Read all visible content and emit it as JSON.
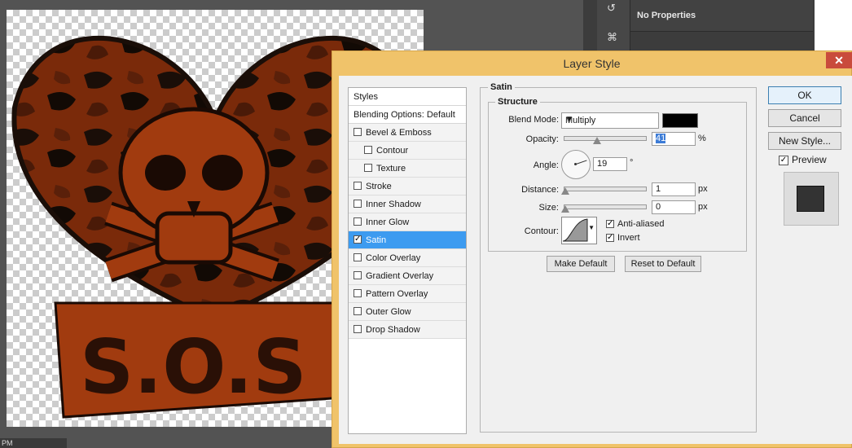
{
  "status_text": "PM",
  "right_panel": {
    "no_properties": "No Properties"
  },
  "dialog": {
    "title": "Layer Style",
    "styles_header": "Styles",
    "blending_options": "Blending Options: Default",
    "effects": [
      {
        "label": "Bevel & Emboss",
        "checked": false,
        "indent": false
      },
      {
        "label": "Contour",
        "checked": false,
        "indent": true
      },
      {
        "label": "Texture",
        "checked": false,
        "indent": true
      },
      {
        "label": "Stroke",
        "checked": false,
        "indent": false
      },
      {
        "label": "Inner Shadow",
        "checked": false,
        "indent": false
      },
      {
        "label": "Inner Glow",
        "checked": false,
        "indent": false
      },
      {
        "label": "Satin",
        "checked": true,
        "indent": false,
        "selected": true
      },
      {
        "label": "Color Overlay",
        "checked": false,
        "indent": false
      },
      {
        "label": "Gradient Overlay",
        "checked": false,
        "indent": false
      },
      {
        "label": "Pattern Overlay",
        "checked": false,
        "indent": false
      },
      {
        "label": "Outer Glow",
        "checked": false,
        "indent": false
      },
      {
        "label": "Drop Shadow",
        "checked": false,
        "indent": false
      }
    ],
    "satin": {
      "group_title": "Satin",
      "structure_title": "Structure",
      "blend_mode_label": "Blend Mode:",
      "blend_mode_value": "Multiply",
      "blend_color": "#000000",
      "opacity_label": "Opacity:",
      "opacity_value": "41",
      "opacity_unit": "%",
      "angle_label": "Angle:",
      "angle_value": "19",
      "angle_unit": "°",
      "distance_label": "Distance:",
      "distance_value": "1",
      "distance_unit": "px",
      "size_label": "Size:",
      "size_value": "0",
      "size_unit": "px",
      "contour_label": "Contour:",
      "anti_aliased_label": "Anti-aliased",
      "anti_aliased_checked": true,
      "invert_label": "Invert",
      "invert_checked": true,
      "make_default": "Make Default",
      "reset_default": "Reset to Default"
    },
    "buttons": {
      "ok": "OK",
      "cancel": "Cancel",
      "new_style": "New Style..."
    },
    "preview_label": "Preview",
    "preview_checked": true
  },
  "canvas": {
    "banner_text": "S.O.S"
  }
}
